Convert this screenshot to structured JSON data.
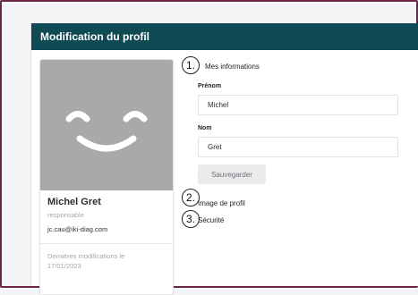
{
  "header": {
    "title": "Modification du profil"
  },
  "profile_card": {
    "name": "Michel Gret",
    "role": "responsable",
    "email": "jc.cau@iki-diag.com",
    "last_modified": "Dernières modifications le 17/01/2023"
  },
  "sections": [
    {
      "number": "1.",
      "title": "Mes informations"
    },
    {
      "number": "2.",
      "title": "Image de profil"
    },
    {
      "number": "3.",
      "title": "Sécurité"
    }
  ],
  "form": {
    "first_name": {
      "label": "Prénom",
      "value": "Michel"
    },
    "last_name": {
      "label": "Nom",
      "value": "Gret"
    },
    "save_label": "Sauvegarder"
  },
  "colors": {
    "header_bg": "#0f4a55",
    "frame_border": "#6b2748",
    "avatar_bg": "#a9a9a9"
  },
  "icons": {
    "avatar": "smiley-face-icon"
  }
}
